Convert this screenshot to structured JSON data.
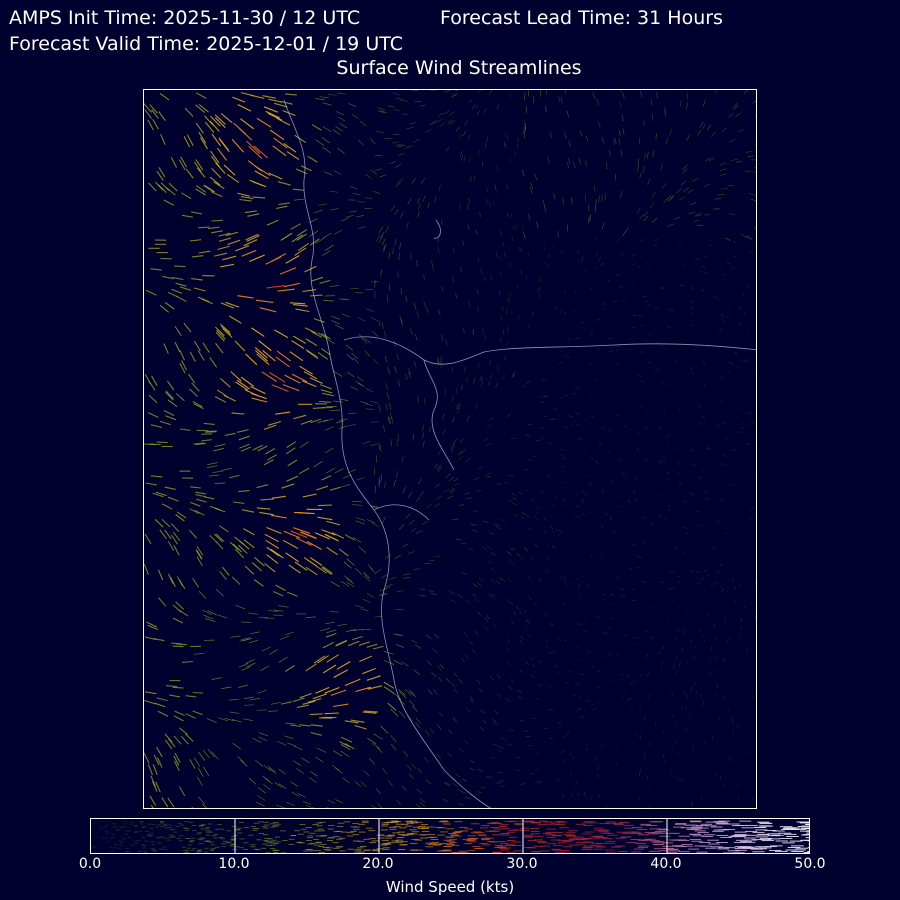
{
  "header": {
    "init_time": "AMPS Init Time: 2025-11-30 / 12 UTC",
    "lead_time": "Forecast Lead Time: 31 Hours",
    "valid_time": "Forecast Valid Time: 2025-12-01 / 19 UTC",
    "map_title": "Surface Wind Streamlines"
  },
  "colorbar": {
    "label": "Wind Speed (kts)",
    "ticks": [
      "0.0",
      "10.0",
      "20.0",
      "30.0",
      "40.0",
      "50.0"
    ],
    "min": 0,
    "max": 50
  },
  "colors": {
    "background": "#00002e",
    "frame": "#ffffff",
    "coastline": "#b8c4e0",
    "speed_ramp": [
      "#1b2a3a",
      "#5a7a2c",
      "#9aa51e",
      "#e0a816",
      "#d0321e",
      "#a02240",
      "#c9a9d9",
      "#ffffff"
    ]
  }
}
